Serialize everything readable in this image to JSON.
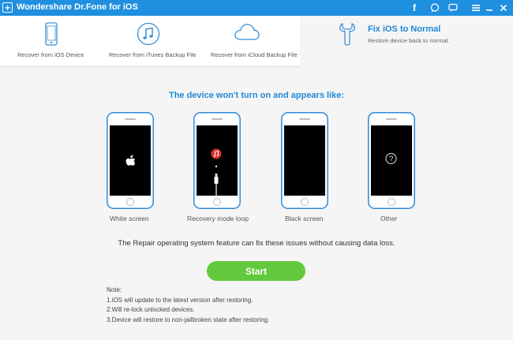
{
  "app": {
    "title": "Wondershare Dr.Fone for iOS",
    "logo_glyph": "+",
    "accent_color": "#1f8fe0"
  },
  "titlebar_icons": [
    "facebook-icon",
    "feedback-icon",
    "chat-icon",
    "menu-icon",
    "minimize-icon",
    "close-icon"
  ],
  "toolbar": {
    "items": [
      {
        "label": "Recover from iOS Device",
        "icon": "phone-icon"
      },
      {
        "label": "Recover from iTunes Backup File",
        "icon": "music-note-icon"
      },
      {
        "label": "Recover from iCloud Backup File",
        "icon": "cloud-icon"
      }
    ],
    "active": {
      "title": "Fix iOS to Normal",
      "subtitle": "Restore device back to normal.",
      "icon": "wrench-icon"
    }
  },
  "main": {
    "heading": "The device won't turn on and appears like:",
    "phones": [
      {
        "label": "White screen",
        "screen": "apple-logo"
      },
      {
        "label": "Recovery mode loop",
        "screen": "itunes-cable"
      },
      {
        "label": "Black screen",
        "screen": "blank"
      },
      {
        "label": "Other",
        "screen": "question"
      }
    ],
    "description": "The Repair operating system feature can fix these issues without causing data loss.",
    "start_label": "Start",
    "start_color": "#63c93c"
  },
  "notes": {
    "title": "Note:",
    "items": [
      "1.iOS will update to the latest version after restoring.",
      "2.Will re-lock unlocked devices.",
      "3.Device will restore to non-jailbroken state after restoring."
    ]
  }
}
